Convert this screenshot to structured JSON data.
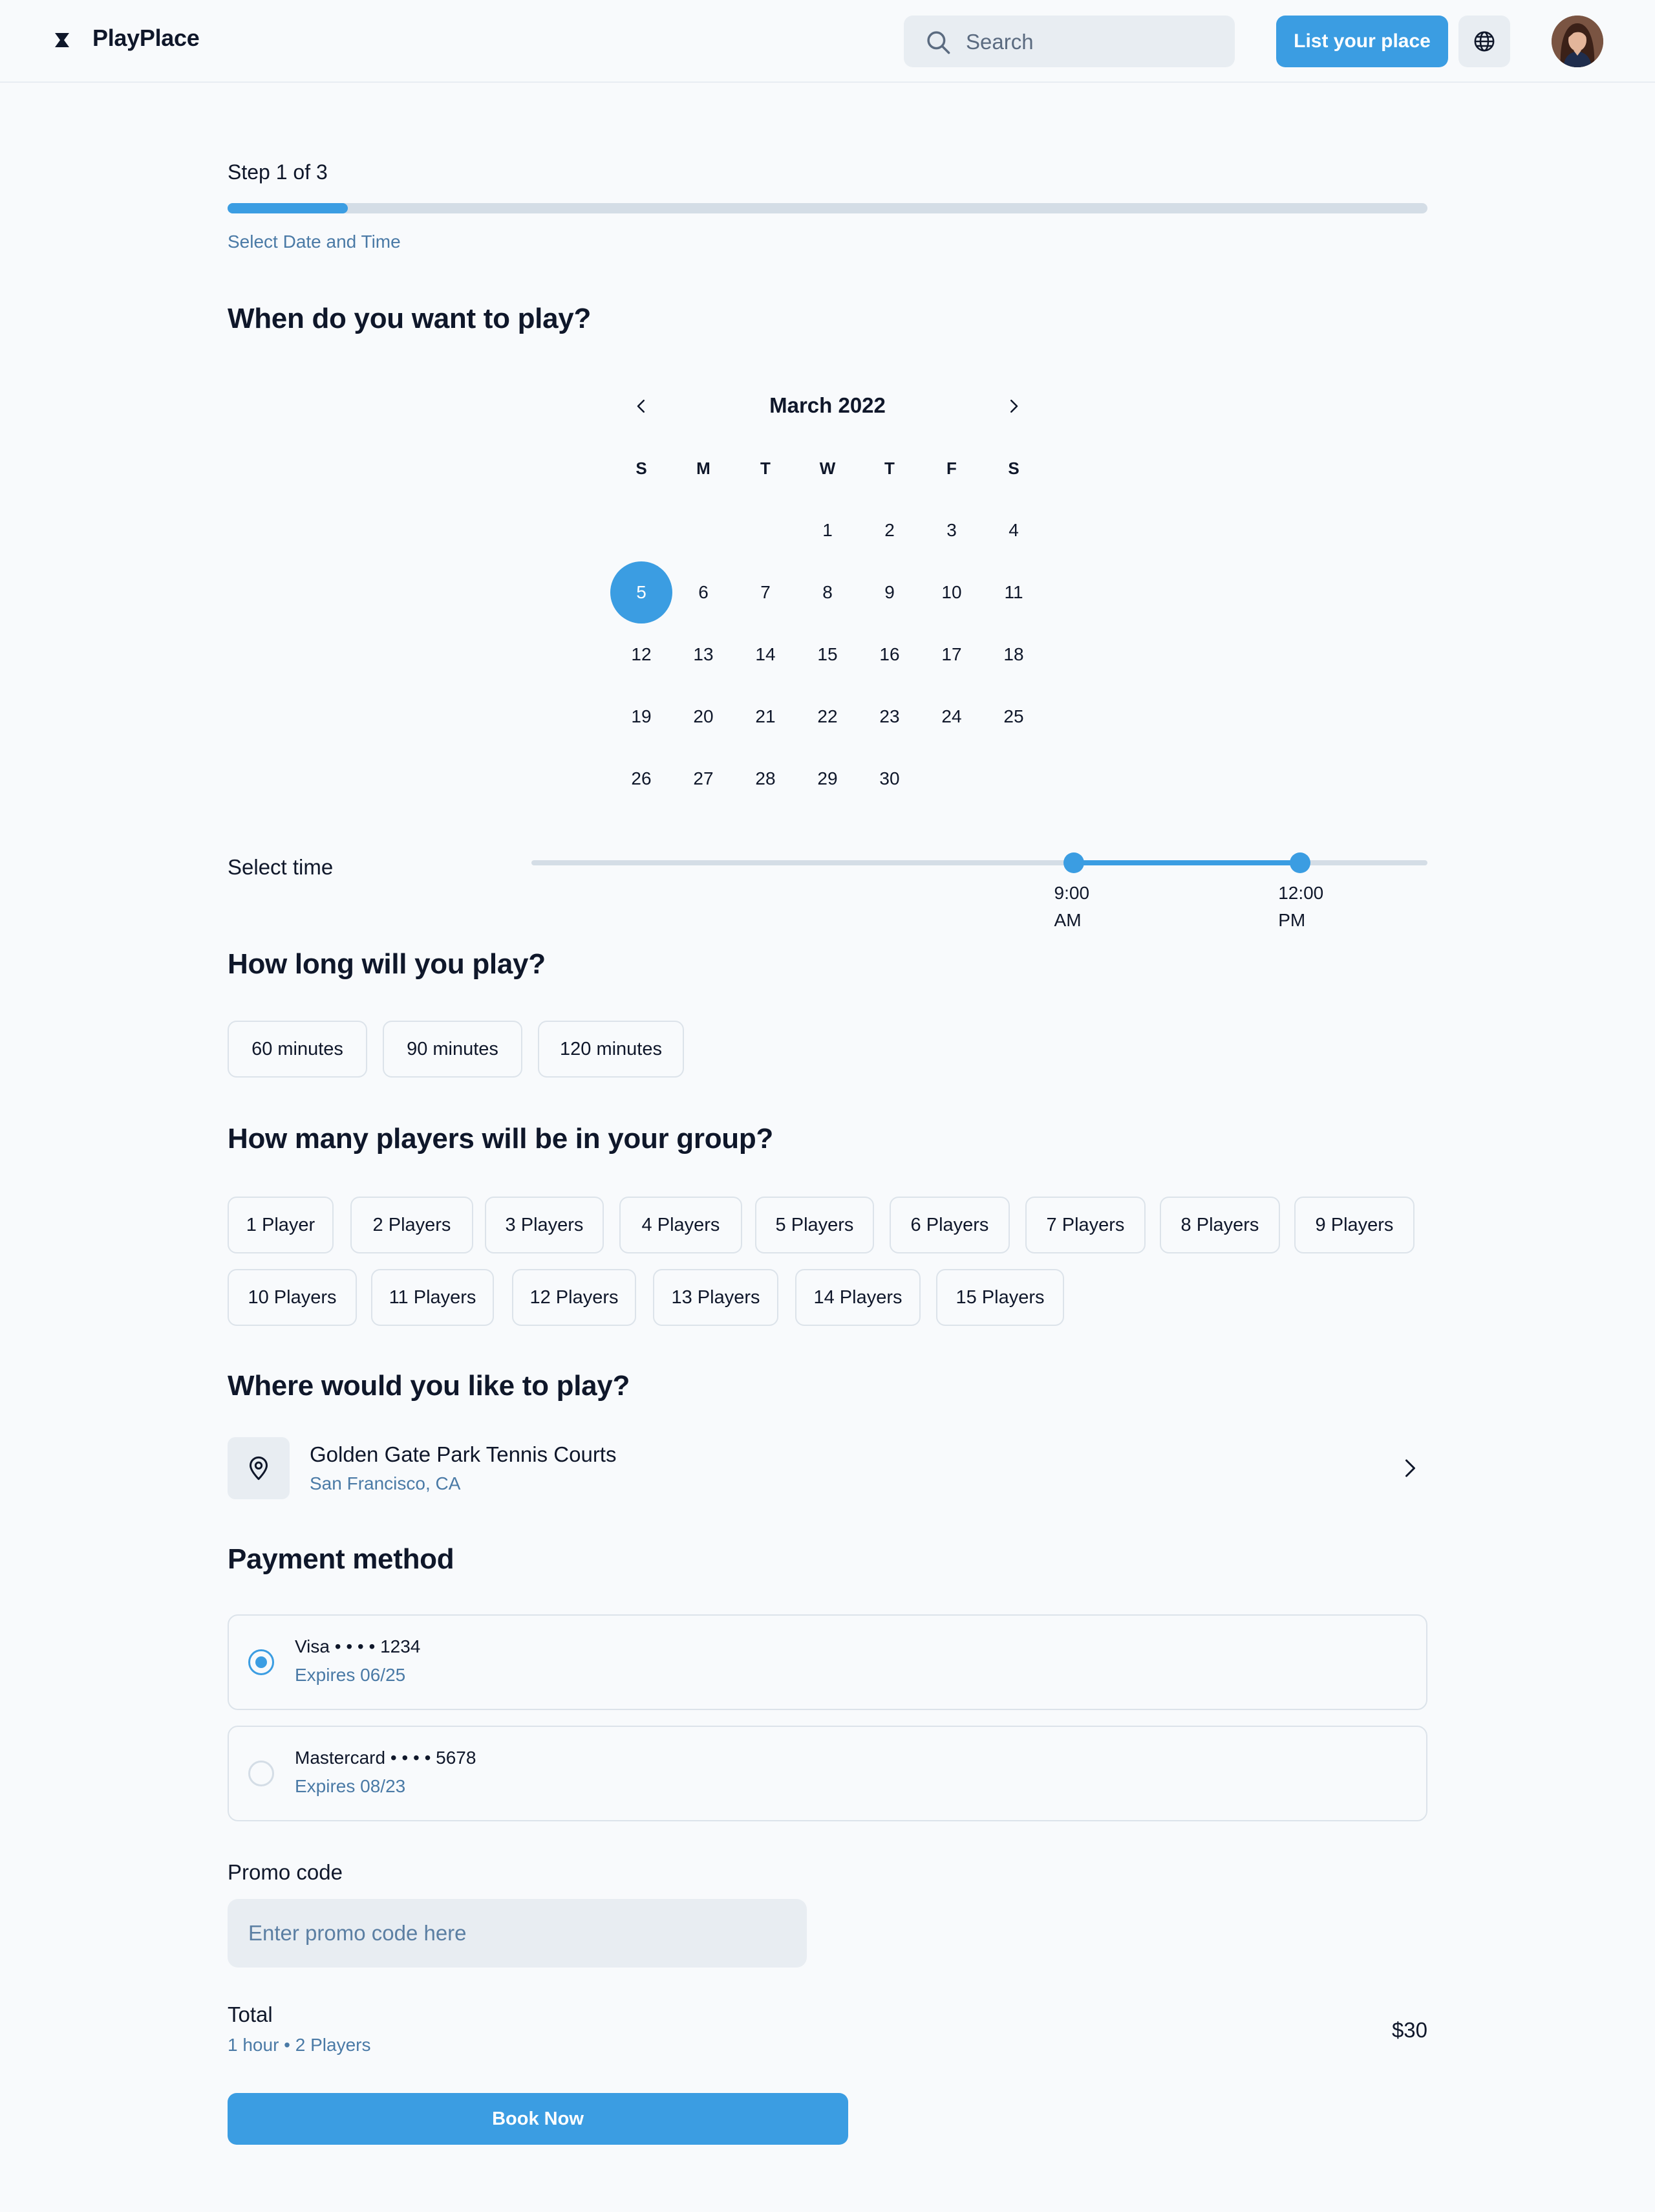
{
  "header": {
    "brand": "PlayPlace",
    "search_placeholder": "Search",
    "list_button": "List your place"
  },
  "progress": {
    "step_label": "Step 1 of 3",
    "fraction": 0.1,
    "sub_label": "Select Date and Time"
  },
  "date_section": {
    "title": "When do you want to play?",
    "month_label": "March 2022",
    "weekday_headers": [
      "S",
      "M",
      "T",
      "W",
      "T",
      "F",
      "S"
    ],
    "first_weekday_index": 3,
    "days_in_month": 30,
    "selected_day": 5
  },
  "time": {
    "label": "Select time",
    "start_value": "9:00 AM",
    "start_line1": "9:00",
    "start_line2": "AM",
    "end_value": "12:00 PM",
    "end_line1": "12:00",
    "end_line2": "PM",
    "start_fraction": 0.605,
    "end_fraction": 0.858
  },
  "duration": {
    "title": "How long will you play?",
    "options": [
      "60 minutes",
      "90 minutes",
      "120 minutes"
    ]
  },
  "players": {
    "title": "How many players will be in your group?",
    "options": [
      "1 Player",
      "2 Players",
      "3 Players",
      "4 Players",
      "5 Players",
      "6 Players",
      "7 Players",
      "8 Players",
      "9 Players",
      "10 Players",
      "11 Players",
      "12 Players",
      "13 Players",
      "14 Players",
      "15 Players"
    ]
  },
  "location": {
    "title": "Where would you like to play?",
    "name": "Golden Gate Park Tennis Courts",
    "city": "San Francisco, CA"
  },
  "payment": {
    "title": "Payment method",
    "cards": [
      {
        "name": "Visa • • • • 1234",
        "expiry": "Expires 06/25",
        "selected": true
      },
      {
        "name": "Mastercard • • • • 5678",
        "expiry": "Expires 08/23",
        "selected": false
      }
    ]
  },
  "promo": {
    "label": "Promo code",
    "placeholder": "Enter promo code here"
  },
  "total": {
    "label": "Total",
    "summary": "1 hour • 2 Players",
    "amount": "$30"
  },
  "book_button": "Book Now",
  "colors": {
    "accent": "#3b9de2",
    "muted_text": "#4a7aa6",
    "track": "#d4dde6",
    "background": "#f8fafc"
  },
  "icons": [
    "logo-icon",
    "search-icon",
    "globe-icon",
    "chevron-left-icon",
    "chevron-right-icon",
    "map-pin-icon"
  ]
}
